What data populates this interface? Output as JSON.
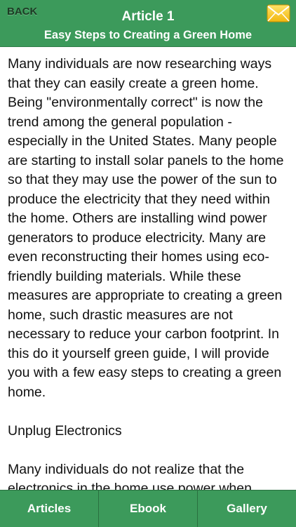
{
  "header": {
    "back_label": "BACK",
    "title": "Article 1",
    "subtitle": "Easy Steps to Creating a Green Home",
    "mail_icon": "envelope-icon"
  },
  "article": {
    "paragraphs": [
      "Many individuals are now researching ways that they can easily create a green home. Being \"environmentally correct\" is now the trend among the general population - especially in the United States. Many people are starting to install solar panels to the home so that they may use the power of the sun to produce the electricity that they need within the home. Others are installing wind power generators to produce electricity. Many are even reconstructing their homes using eco-friendly building materials. While these measures are appropriate to creating a green home, such drastic measures are not necessary to reduce your carbon footprint. In this do it yourself green guide, I will provide you with a few easy steps to creating a green home.",
      "Unplug Electronics",
      "Many individuals do not realize that the electronics in the home use power when"
    ]
  },
  "tabbar": {
    "articles_label": "Articles",
    "ebook_label": "Ebook",
    "gallery_label": "Gallery"
  },
  "colors": {
    "header_green": "#3c9a5b",
    "back_text": "#1d3b24",
    "envelope_yellow": "#f5c518"
  }
}
